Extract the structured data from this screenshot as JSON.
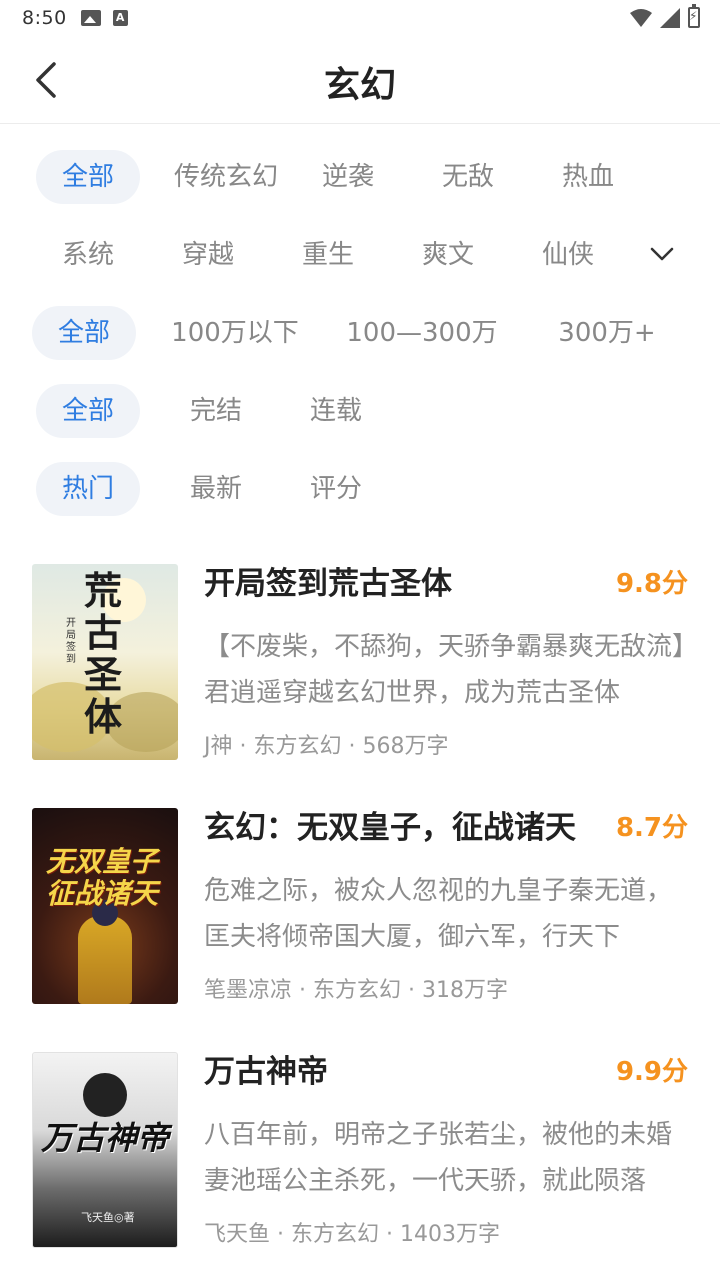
{
  "status_bar": {
    "time": "8:50"
  },
  "header": {
    "title": "玄幻"
  },
  "filters": {
    "subcategories": [
      "全部",
      "传统玄幻",
      "逆袭",
      "无敌",
      "热血",
      "系统",
      "穿越",
      "重生",
      "爽文",
      "仙侠"
    ],
    "word_counts": [
      "全部",
      "100万以下",
      "100—300万",
      "300万+"
    ],
    "status": [
      "全部",
      "完结",
      "连载"
    ],
    "sort": [
      "热门",
      "最新",
      "评分"
    ]
  },
  "books": [
    {
      "title": "开局签到荒古圣体",
      "score": "9.8分",
      "desc": "【不废柴，不舔狗，天骄争霸暴爽无敌流】君逍遥穿越玄幻世界，成为荒古圣体",
      "author": "J神",
      "genre": "东方玄幻",
      "words": "568万字",
      "cover_text": "荒古圣体",
      "cover_sub": "开局签到"
    },
    {
      "title": "玄幻：无双皇子，征战诸天",
      "score": "8.7分",
      "desc": "危难之际，被众人忽视的九皇子秦无道，匡夫将倾帝国大厦，御六军，行天下",
      "author": "笔墨凉凉",
      "genre": "东方玄幻",
      "words": "318万字",
      "cover_text": "无双皇子征战诸天"
    },
    {
      "title": "万古神帝",
      "score": "9.9分",
      "desc": "八百年前，明帝之子张若尘，被他的未婚妻池瑶公主杀死，一代天骄，就此陨落",
      "author": "飞天鱼",
      "genre": "东方玄幻",
      "words": "1403万字",
      "cover_text": "万古神帝",
      "cover_sub": "飞天鱼◎著"
    }
  ],
  "meta_separator": " · "
}
